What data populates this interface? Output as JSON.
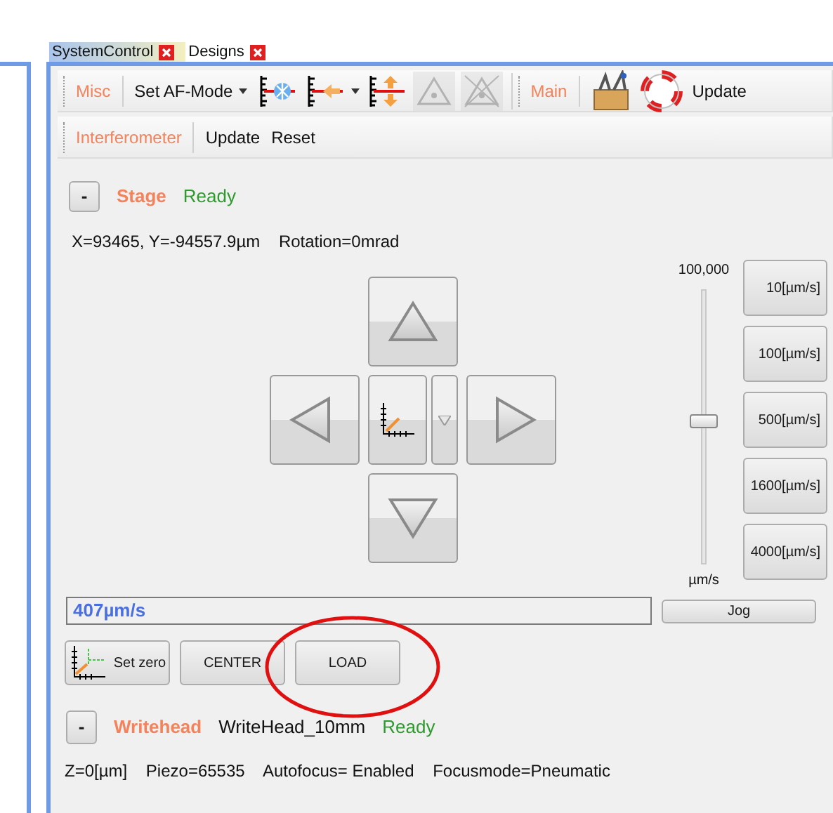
{
  "tabs": [
    {
      "label": "SystemControl",
      "selected": true
    },
    {
      "label": "Designs",
      "selected": false
    }
  ],
  "toolbar": {
    "groups": [
      {
        "title": "Misc",
        "items": [
          {
            "kind": "dropdown",
            "label": "Set AF-Mode"
          },
          {
            "kind": "icon",
            "disabled": false
          },
          {
            "kind": "icon",
            "disabled": false,
            "dropdown": true
          },
          {
            "kind": "icon",
            "disabled": false
          },
          {
            "kind": "icon",
            "disabled": true
          },
          {
            "kind": "icon",
            "disabled": true
          }
        ]
      },
      {
        "title": "Main",
        "items": [
          {
            "kind": "icon",
            "disabled": false
          },
          {
            "kind": "icon",
            "disabled": false
          },
          {
            "kind": "button",
            "label": "Update"
          }
        ]
      }
    ]
  },
  "toolbar2": {
    "groups": [
      {
        "title": "Interferometer",
        "items": [
          {
            "kind": "button",
            "label": "Update"
          },
          {
            "kind": "button",
            "label": "Reset"
          }
        ]
      }
    ]
  },
  "stage": {
    "collapse": "-",
    "title": "Stage",
    "status": "Ready",
    "position": "X=93465, Y=-94557.9µm    Rotation=0mrad",
    "slider": {
      "max_label": "100,000",
      "unit": "µm/s",
      "level": 0.52
    },
    "speeds": [
      "10[µm/s]",
      "100[µm/s]",
      "500[µm/s]",
      "1600[µm/s]",
      "4000[µm/s]"
    ],
    "speed_value": "407µm/s",
    "jog": "Jog",
    "actions": [
      "Set zero",
      "CENTER",
      "LOAD"
    ]
  },
  "writehead": {
    "collapse": "-",
    "title": "Writehead",
    "name": "WriteHead_10mm",
    "status": "Ready",
    "info": "Z=0[µm]    Piezo=65535    Autofocus= Enabled    Focusmode=Pneumatic"
  }
}
